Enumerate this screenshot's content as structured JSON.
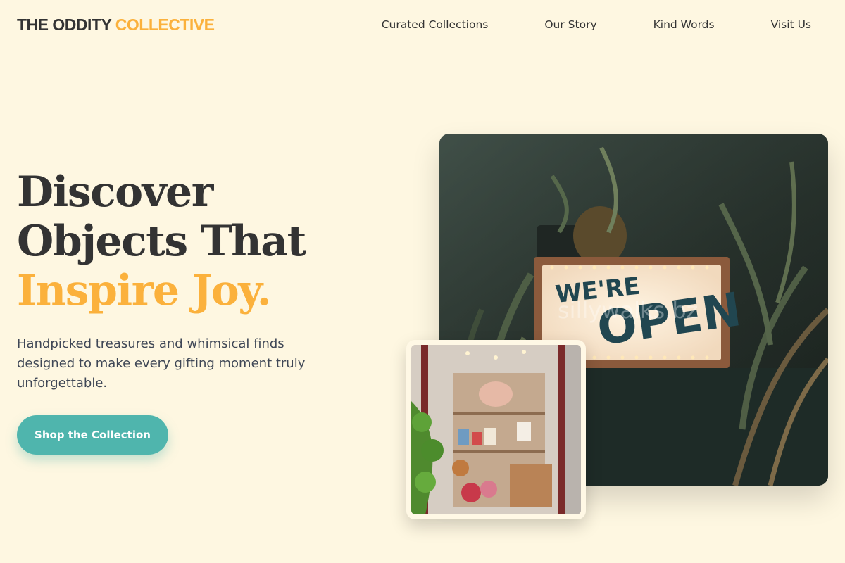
{
  "brand": {
    "name_main": "THE ODDITY",
    "name_accent": "COLLECTIVE"
  },
  "nav": [
    {
      "label": "Curated Collections"
    },
    {
      "label": "Our Story"
    },
    {
      "label": "Kind Words"
    },
    {
      "label": "Visit Us"
    }
  ],
  "hero": {
    "title_line1": "Discover",
    "title_line2": "Objects That",
    "title_accent": "Inspire Joy.",
    "subtitle": "Handpicked treasures and whimsical finds designed to make every gifting moment truly unforgettable.",
    "cta_label": "Shop the Collection"
  },
  "main_image": {
    "sign_line1": "WE'RE",
    "sign_line2": "OPEN",
    "watermark": "sillywalks.bz"
  },
  "colors": {
    "background": "#fef7e1",
    "text": "#333333",
    "accent": "#fbb13c",
    "button": "#4fb5ad"
  }
}
